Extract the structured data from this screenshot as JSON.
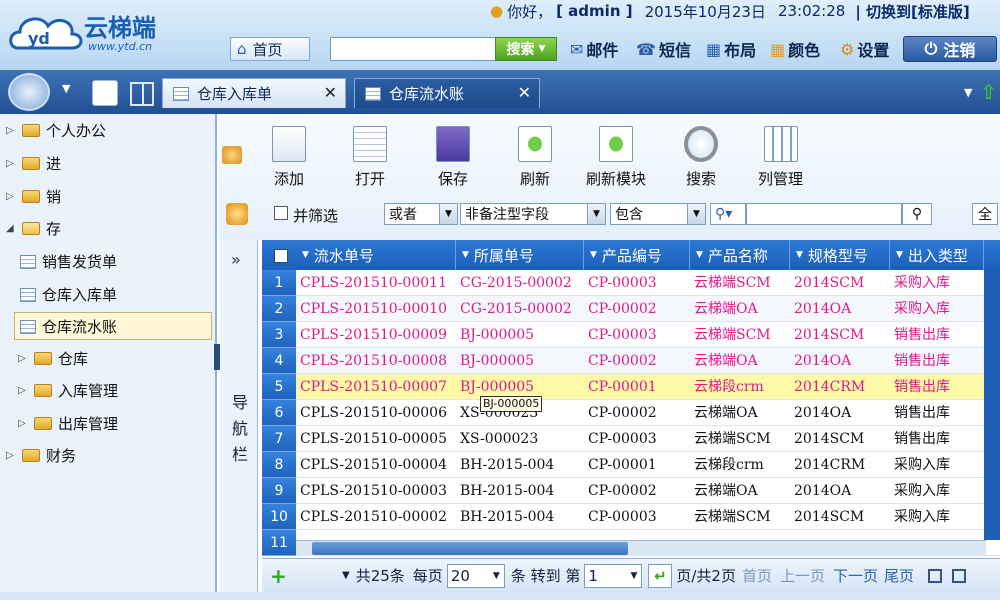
{
  "app": {
    "logo_text": "云梯端",
    "logo_url": "www.ytd.cn",
    "greeting": "你好，",
    "user": "[ admin ]",
    "date": "2015年10月23日",
    "time": "23:02:28",
    "switch": "| 切换到[标准版]",
    "home": "首页",
    "search_button": "搜索",
    "mail": "邮件",
    "sms": "短信",
    "layout": "布局",
    "color": "颜色",
    "settings": "设置",
    "logout": "注销"
  },
  "tabs": [
    {
      "label": "仓库入库单"
    },
    {
      "label": "仓库流水账"
    }
  ],
  "sidebar": {
    "items": [
      {
        "label": "个人办公"
      },
      {
        "label": "进"
      },
      {
        "label": "销"
      },
      {
        "label": "存"
      },
      {
        "label": "销售发货单"
      },
      {
        "label": "仓库入库单"
      },
      {
        "label": "仓库流水账"
      },
      {
        "label": "仓库"
      },
      {
        "label": "入库管理"
      },
      {
        "label": "出库管理"
      },
      {
        "label": "财务"
      }
    ],
    "collapse": "»",
    "nav_label_1": "导",
    "nav_label_2": "航",
    "nav_label_3": "栏"
  },
  "toolbar": {
    "add": "添加",
    "open": "打开",
    "save": "保存",
    "refresh": "刷新",
    "refresh_module": "刷新模块",
    "search": "搜索",
    "columns": "列管理"
  },
  "filter": {
    "and_filter": "并筛选",
    "logic": "或者",
    "field": "非备注型字段",
    "op": "包含",
    "select_all": "全"
  },
  "grid": {
    "headers": [
      "流水单号",
      "所属单号",
      "产品编号",
      "产品名称",
      "规格型号",
      "出入类型"
    ],
    "rows": [
      {
        "n": "1",
        "c": [
          "CPLS-201510-00011",
          "CG-2015-00002",
          "CP-00003",
          "云梯端SCM",
          "2014SCM",
          "采购入库"
        ]
      },
      {
        "n": "2",
        "c": [
          "CPLS-201510-00010",
          "CG-2015-00002",
          "CP-00002",
          "云梯端OA",
          "2014OA",
          "采购入库"
        ]
      },
      {
        "n": "3",
        "c": [
          "CPLS-201510-00009",
          "BJ-000005",
          "CP-00003",
          "云梯端SCM",
          "2014SCM",
          "销售出库"
        ]
      },
      {
        "n": "4",
        "c": [
          "CPLS-201510-00008",
          "BJ-000005",
          "CP-00002",
          "云梯端OA",
          "2014OA",
          "销售出库"
        ]
      },
      {
        "n": "5",
        "c": [
          "CPLS-201510-00007",
          "BJ-000005",
          "CP-00001",
          "云梯段crm",
          "2014CRM",
          "销售出库"
        ]
      },
      {
        "n": "6",
        "c": [
          "CPLS-201510-00006",
          "XS-000023",
          "CP-00002",
          "云梯端OA",
          "2014OA",
          "销售出库"
        ]
      },
      {
        "n": "7",
        "c": [
          "CPLS-201510-00005",
          "XS-000023",
          "CP-00003",
          "云梯端SCM",
          "2014SCM",
          "销售出库"
        ]
      },
      {
        "n": "8",
        "c": [
          "CPLS-201510-00004",
          "BH-2015-004",
          "CP-00001",
          "云梯段crm",
          "2014CRM",
          "采购入库"
        ]
      },
      {
        "n": "9",
        "c": [
          "CPLS-201510-00003",
          "BH-2015-004",
          "CP-00002",
          "云梯端OA",
          "2014OA",
          "采购入库"
        ]
      },
      {
        "n": "10",
        "c": [
          "CPLS-201510-00002",
          "BH-2015-004",
          "CP-00003",
          "云梯端SCM",
          "2014SCM",
          "采购入库"
        ]
      },
      {
        "n": "11",
        "c": [
          "",
          "",
          "",
          "",
          "",
          ""
        ]
      }
    ],
    "tooltip": "BJ-000005"
  },
  "footer": {
    "total": "共25条",
    "per_page_label": "每页",
    "per_page": "20",
    "goto_label": "条 转到 第",
    "page": "1",
    "page_total": "页/共2页",
    "first": "首页",
    "prev": "上一页",
    "next": "下一页",
    "last": "尾页"
  },
  "colors": {
    "pink": "#e0198c",
    "header_blue": "#1f63bd",
    "highlight": "#fff9a8"
  }
}
